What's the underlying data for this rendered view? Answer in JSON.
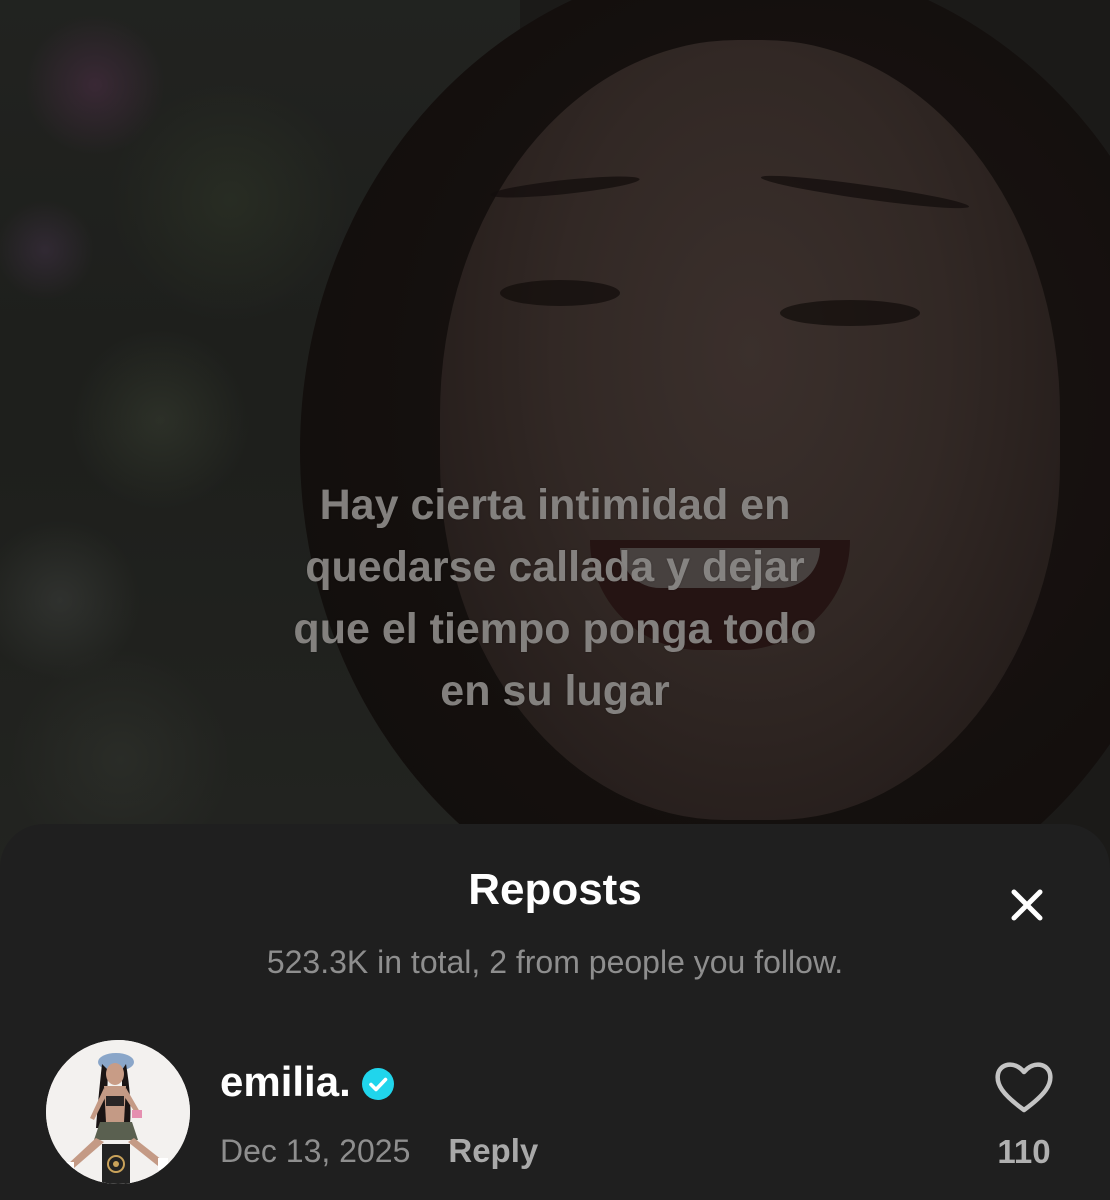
{
  "video": {
    "caption_lines": [
      "Hay cierta intimidad en",
      "quedarse callada y dejar",
      "que el tiempo ponga todo",
      "en su lugar"
    ]
  },
  "sheet": {
    "title": "Reposts",
    "subtitle": "523.3K in total, 2 from people you follow.",
    "close_icon": "close-icon"
  },
  "reposts": [
    {
      "username": "emilia.",
      "verified": true,
      "date": "Dec 13, 2025",
      "reply_label": "Reply",
      "like_count": "110",
      "like_icon": "heart-outline-icon",
      "avatar_icon": "profile-photo"
    }
  ],
  "colors": {
    "sheet_bg": "#1f1f1f",
    "verified_blue": "#20d5ec",
    "text_primary": "#ffffff",
    "text_secondary": "#8e8e8e"
  }
}
